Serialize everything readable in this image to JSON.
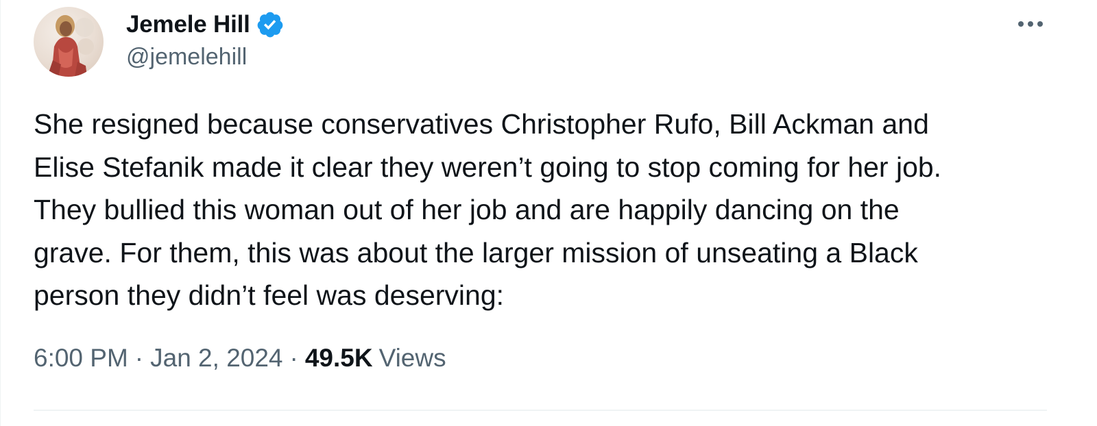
{
  "author": {
    "display_name": "Jemele Hill",
    "handle": "@jemelehill",
    "verified": true,
    "verified_color": "#1d9bf0"
  },
  "tweet": {
    "lines": [
      "She resigned because conservatives Christopher Rufo, Bill Ackman and",
      "Elise Stefanik made it clear they weren’t going to stop coming for her job.",
      "They bullied this woman out of her job and are happily dancing on the",
      "grave. For them, this was about the larger mission of unseating a Black",
      "person they didn’t feel was deserving:"
    ]
  },
  "meta": {
    "time": "6:00 PM",
    "separator": "·",
    "date": "Jan 2, 2024",
    "views_count": "49.5K",
    "views_label": "Views"
  },
  "icons": {
    "more": "more-options-icon",
    "verified": "verified-badge-icon"
  },
  "colors": {
    "text_primary": "#0f1419",
    "text_secondary": "#536471",
    "divider": "#eff3f4"
  }
}
